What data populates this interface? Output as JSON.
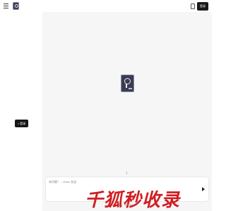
{
  "topbar": {
    "login_label": "登录",
    "menu_icon": "menu-icon",
    "device_icon": "mobile-icon"
  },
  "sidebar": {
    "login_label": "< 登录"
  },
  "main": {
    "input_placeholder": "有问题？...  Enter 发送"
  },
  "watermark": {
    "text": "千狐秒收录",
    "sub": "qianhu..."
  },
  "colors": {
    "accent_dark": "#161616",
    "watermark_red": "#d01e22",
    "main_bg": "#f6f6f7"
  }
}
